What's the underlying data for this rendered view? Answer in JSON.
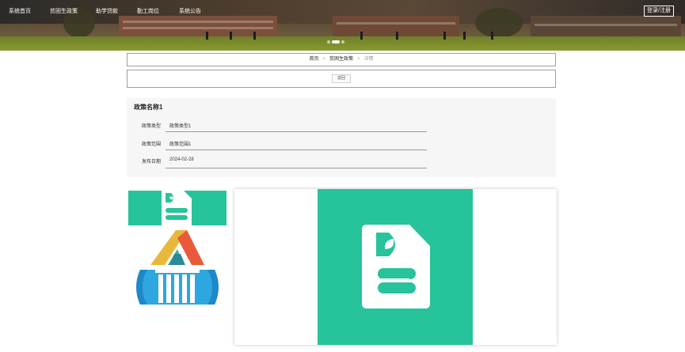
{
  "nav": {
    "items": [
      "系统首页",
      "贫困生政策",
      "助学贷款",
      "勤工岗位",
      "系统公告"
    ],
    "login_label": "登录/注册"
  },
  "carousel": {
    "slides": 3,
    "active": 1
  },
  "breadcrumb": {
    "items": [
      "首页",
      "贫困生政策",
      "详情"
    ],
    "separator": ">"
  },
  "back_label": "返回",
  "detail": {
    "title": "政策名称1",
    "fields": [
      {
        "label": "政策类型",
        "value": "政策类型1"
      },
      {
        "label": "政策范围",
        "value": "政策范围1"
      },
      {
        "label": "发布日期",
        "value": "2024-02-28"
      }
    ]
  },
  "gallery": {
    "thumbnails": [
      "document-leaf-icon",
      "triangle-logo-icon",
      "columns-logo-icon"
    ],
    "main": "document-leaf-icon"
  },
  "colors": {
    "accent": "#27c39a",
    "panel_bg": "#f6f6f6"
  }
}
